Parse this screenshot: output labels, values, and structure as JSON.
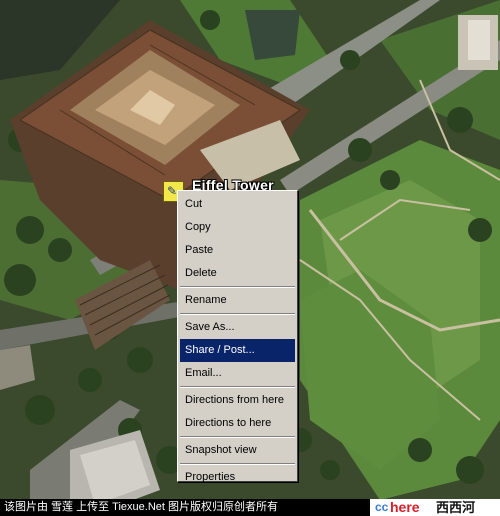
{
  "placemark": {
    "label": "Eiffel Tower",
    "icon": "placemark-pin-icon"
  },
  "context_menu": {
    "groups": [
      [
        "Cut",
        "Copy",
        "Paste",
        "Delete"
      ],
      [
        "Rename"
      ],
      [
        "Save As...",
        "Share / Post...",
        "Email..."
      ],
      [
        "Directions from here",
        "Directions to here"
      ],
      [
        "Snapshot view"
      ],
      [
        "Properties"
      ]
    ],
    "selected": "Share / Post..."
  },
  "footer": {
    "caption": "该图片由 雪莲 上传至 Tiexue.Net 图片版权归原创者所有",
    "brand_cc": "cc",
    "brand_here": "here",
    "brand_site": "西西河"
  },
  "colors": {
    "selection": "#0a246a",
    "menu_bg": "#d4d0c8",
    "pin": "#f2e84a"
  }
}
